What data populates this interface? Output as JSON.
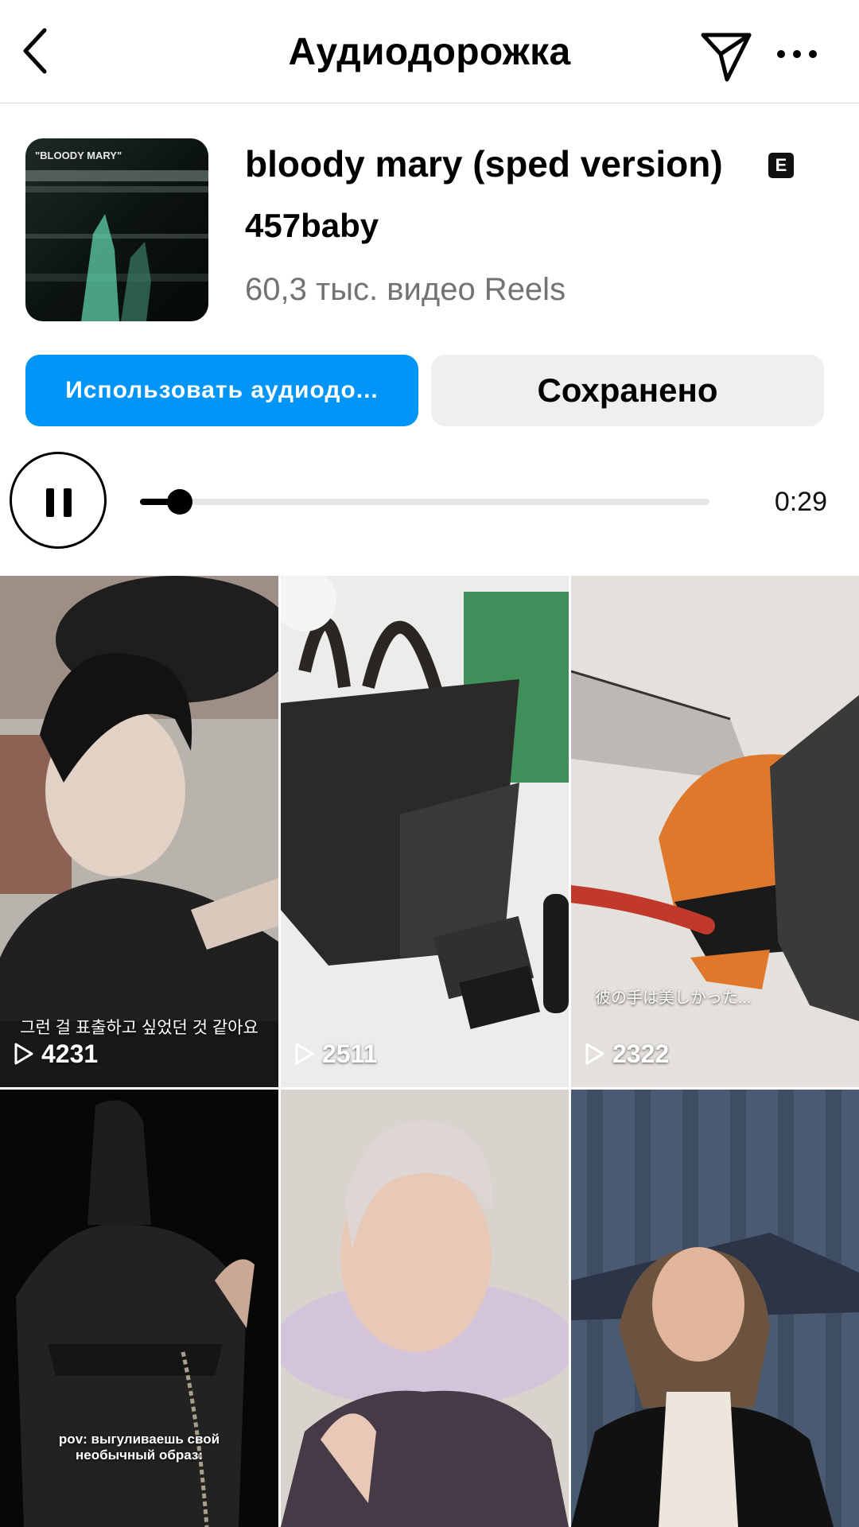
{
  "header": {
    "title": "Аудиодорожка",
    "back_icon": "chevron-left-icon",
    "share_icon": "paper-plane-icon",
    "more_icon": "more-horizontal-icon"
  },
  "track": {
    "cover_text": "\"BLOODY MARY\"",
    "title": "bloody mary (sped version)",
    "explicit_badge": "E",
    "artist": "457baby",
    "reels_count": "60,3 тыс. видео Reels"
  },
  "actions": {
    "use_audio_label": "Использовать аудиодо...",
    "saved_label": "Сохранено"
  },
  "player": {
    "state": "playing",
    "progress": 0.07,
    "duration": "0:29"
  },
  "reels": [
    {
      "caption": "그런 걸 표출하고 싶었던 것 같아요",
      "views": "4231"
    },
    {
      "caption": "",
      "views": "2511"
    },
    {
      "caption": "彼の手は美しかった...",
      "views": "2322"
    },
    {
      "caption": "pov: выгуливаешь свой необычный образ:",
      "views": ""
    },
    {
      "caption": "",
      "views": ""
    },
    {
      "caption": "",
      "views": ""
    }
  ],
  "colors": {
    "accent": "#0095f6",
    "secondary_button": "#efefef",
    "muted_text": "#737373"
  }
}
